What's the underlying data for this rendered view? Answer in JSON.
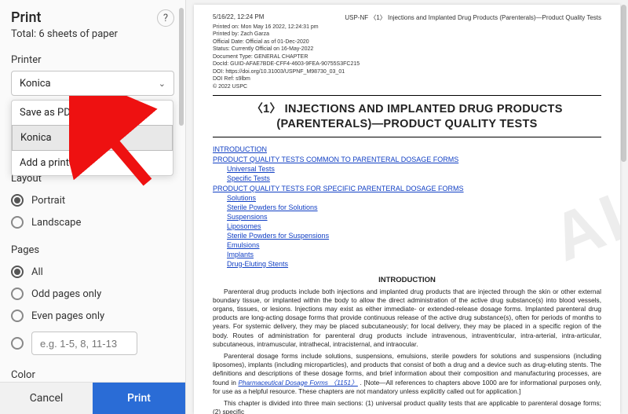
{
  "dialog": {
    "title": "Print",
    "subtitle": "Total: 6 sheets of paper",
    "help_tooltip": "?",
    "printer": {
      "label": "Printer",
      "selectedValue": "Konica",
      "options": [
        {
          "label": "Save as PDF",
          "selected": false
        },
        {
          "label": "Konica",
          "selected": true
        },
        {
          "label": "Add a printer",
          "selected": false
        }
      ]
    },
    "layout": {
      "label": "Layout",
      "options": [
        {
          "label": "Portrait",
          "checked": true
        },
        {
          "label": "Landscape",
          "checked": false
        }
      ]
    },
    "pages": {
      "label": "Pages",
      "options": [
        {
          "label": "All",
          "checked": true
        },
        {
          "label": "Odd pages only",
          "checked": false
        },
        {
          "label": "Even pages only",
          "checked": false
        }
      ],
      "customPlaceholder": "e.g. 1-5, 8, 11-13"
    },
    "color_label": "Color",
    "buttons": {
      "cancel": "Cancel",
      "print": "Print"
    }
  },
  "preview": {
    "header": {
      "datetime": "5/16/22, 12:24 PM",
      "docline": "USP-NF 〈1〉 Injections and Implanted Drug Products (Parenterals)—Product Quality Tests"
    },
    "meta": [
      "Printed on: Mon May 16 2022, 12:24:31 pm",
      "Printed by: Zach Garza",
      "Official Date: Official as of 01-Dec-2020",
      "Status: Currently Official on 16-May-2022",
      "Document Type: GENERAL CHAPTER",
      "DocId: GUID-AFAE7BDE-CFF4-4603-9FEA-90755S3FC215",
      "DOI: https://doi.org/10.31003/USPNF_M98730_03_01",
      "DOI Ref: s9lbm",
      "© 2022 USPC"
    ],
    "title_line1": "〈1〉 INJECTIONS AND IMPLANTED DRUG PRODUCTS",
    "title_line2": "(PARENTERALS)—PRODUCT QUALITY TESTS",
    "toc": [
      {
        "level": 0,
        "text": "INTRODUCTION"
      },
      {
        "level": 0,
        "text": "PRODUCT QUALITY TESTS COMMON TO PARENTERAL DOSAGE FORMS"
      },
      {
        "level": 1,
        "text": "Universal Tests"
      },
      {
        "level": 1,
        "text": "Specific Tests"
      },
      {
        "level": 0,
        "text": "PRODUCT QUALITY TESTS FOR SPECIFIC PARENTERAL DOSAGE FORMS"
      },
      {
        "level": 1,
        "text": "Solutions"
      },
      {
        "level": 1,
        "text": "Sterile Powders for Solutions"
      },
      {
        "level": 1,
        "text": "Suspensions"
      },
      {
        "level": 1,
        "text": "Liposomes"
      },
      {
        "level": 1,
        "text": "Sterile Powders for Suspensions"
      },
      {
        "level": 1,
        "text": "Emulsions"
      },
      {
        "level": 1,
        "text": "Implants"
      },
      {
        "level": 1,
        "text": "Drug-Eluting Stents"
      }
    ],
    "watermark": "AL",
    "intro_heading": "INTRODUCTION",
    "paragraphs": [
      "Parenteral drug products include both injections and implanted drug products that are injected through the skin or other external boundary tissue, or implanted within the body to allow the direct administration of the active drug substance(s) into blood vessels, organs, tissues, or lesions. Injections may exist as either immediate- or extended-release dosage forms. Implanted parenteral drug products are long-acting dosage forms that provide continuous release of the active drug substance(s), often for periods of months to years. For systemic delivery, they may be placed subcutaneously; for local delivery, they may be placed in a specific region of the body. Routes of administration for parenteral drug products include intravenous, intraventricular, intra-arterial, intra-articular, subcutaneous, intramuscular, intrathecal, intracisternal, and intraocular.",
      "Parenteral dosage forms include solutions, suspensions, emulsions, sterile powders for solutions and suspensions (including liposomes), implants (including microparticles), and products that consist of both a drug and a device such as drug-eluting stents. The definitions and descriptions of these dosage forms, and brief information about their composition and manufacturing processes, are found in ",
      "This chapter is divided into three main sections: (1) universal product quality tests that are applicable to parenteral dosage forms; (2) specific"
    ],
    "link_text": "Pharmaceutical Dosage Forms 〈1151〉",
    "note_text": ". [Note—All references to chapters above 1000 are for informational purposes only, for use as a helpful resource. These chapters are not mandatory unless explicitly called out for application.]"
  }
}
